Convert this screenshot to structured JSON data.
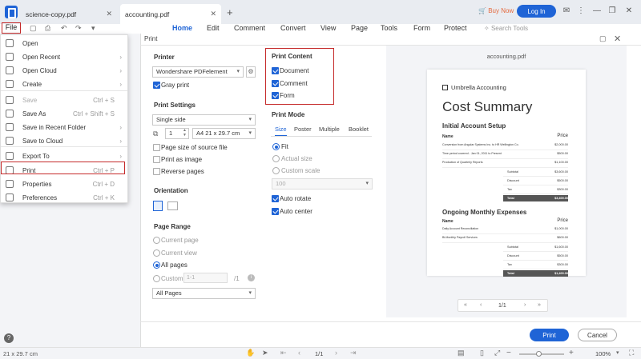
{
  "tabs": [
    {
      "label": "science-copy.pdf"
    },
    {
      "label": "accounting.pdf"
    }
  ],
  "header": {
    "buy_now": "Buy Now",
    "login": "Log In"
  },
  "toolbar": {
    "file": "File",
    "menus": [
      "Home",
      "Edit",
      "Comment",
      "Convert",
      "View",
      "Page",
      "Tools",
      "Form",
      "Protect"
    ],
    "search": "Search Tools"
  },
  "file_menu": [
    {
      "label": "Open",
      "shortcut": "",
      "arrow": false,
      "disabled": false
    },
    {
      "label": "Open Recent",
      "shortcut": "",
      "arrow": true,
      "disabled": false
    },
    {
      "label": "Open Cloud",
      "shortcut": "",
      "arrow": true,
      "disabled": false
    },
    {
      "label": "Create",
      "shortcut": "",
      "arrow": true,
      "disabled": false
    },
    {
      "label": "Save",
      "shortcut": "Ctrl + S",
      "arrow": false,
      "disabled": true
    },
    {
      "label": "Save As",
      "shortcut": "Ctrl + Shift + S",
      "arrow": false,
      "disabled": false
    },
    {
      "label": "Save in Recent Folder",
      "shortcut": "",
      "arrow": true,
      "disabled": false
    },
    {
      "label": "Save to Cloud",
      "shortcut": "",
      "arrow": true,
      "disabled": false
    },
    {
      "label": "Export To",
      "shortcut": "",
      "arrow": true,
      "disabled": false
    },
    {
      "label": "Print",
      "shortcut": "Ctrl + P",
      "arrow": false,
      "disabled": false
    },
    {
      "label": "Properties",
      "shortcut": "Ctrl + D",
      "arrow": false,
      "disabled": false
    },
    {
      "label": "Preferences",
      "shortcut": "Ctrl + K",
      "arrow": false,
      "disabled": false
    }
  ],
  "dialog": {
    "title": "Print",
    "printer": {
      "heading": "Printer",
      "selected": "Wondershare PDFelement",
      "gray_print": "Gray print",
      "gray_checked": true
    },
    "settings": {
      "heading": "Print Settings",
      "sides": "Single side",
      "copies": "1",
      "paper": "A4 21 x 29.7 cm",
      "options": [
        {
          "label": "Page size of source file",
          "checked": false
        },
        {
          "label": "Print as image",
          "checked": false
        },
        {
          "label": "Reverse pages",
          "checked": false
        }
      ]
    },
    "orientation": {
      "heading": "Orientation"
    },
    "page_range": {
      "heading": "Page Range",
      "options": [
        {
          "label": "Current page",
          "selected": false
        },
        {
          "label": "Current view",
          "selected": false
        },
        {
          "label": "All pages",
          "selected": true
        },
        {
          "label": "Custom",
          "selected": false
        }
      ],
      "custom_value": "1-1",
      "custom_total": "/1",
      "subset": "All Pages"
    },
    "print_content": {
      "heading": "Print Content",
      "items": [
        {
          "label": "Document",
          "checked": true
        },
        {
          "label": "Comment",
          "checked": true
        },
        {
          "label": "Form",
          "checked": true
        }
      ]
    },
    "print_mode": {
      "heading": "Print Mode",
      "tabs": [
        "Size",
        "Poster",
        "Multiple",
        "Booklet"
      ],
      "size_options": [
        {
          "label": "Fit",
          "selected": true
        },
        {
          "label": "Actual size",
          "selected": false
        },
        {
          "label": "Custom scale",
          "selected": false
        }
      ],
      "scale_value": "100",
      "auto_rotate": "Auto rotate",
      "auto_center": "Auto center"
    },
    "preview": {
      "filename": "accounting.pdf",
      "page_indicator": "1/1",
      "doc": {
        "brand": "Umbrella Accounting",
        "title": "Cost Summary",
        "section1": "Initial Account Setup",
        "col_name": "Name",
        "col_price": "Price",
        "rows1": [
          {
            "name": "Conversion from Angular Systems Inc. to HR Wellington Co.",
            "price": "$2,000.00"
          },
          {
            "name": "Time period covered - Jan 01, 2011 to Present",
            "price": "$500.00"
          },
          {
            "name": "Production of Quarterly Reports",
            "price": "$1,100.00"
          }
        ],
        "totals1": [
          {
            "label": "Subtotal",
            "value": "$3,600.00"
          },
          {
            "label": "Discount",
            "value": "$500.00"
          },
          {
            "label": "Tax",
            "value": "$300.00"
          },
          {
            "label": "Total",
            "value": "$3,400.00"
          }
        ],
        "section2": "Ongoing Monthly Expenses",
        "rows2": [
          {
            "name": "Daily Account Reconciliation",
            "price": "$1,000.00"
          },
          {
            "name": "Bi-Monthly Payroll Services",
            "price": "$600.00"
          }
        ],
        "totals2": [
          {
            "label": "Subtotal",
            "value": "$1,600.00"
          },
          {
            "label": "Discount",
            "value": "$500.00"
          },
          {
            "label": "Tax",
            "value": "$300.00"
          },
          {
            "label": "Total",
            "value": "$1,400.00"
          }
        ]
      }
    },
    "buttons": {
      "print": "Print",
      "cancel": "Cancel"
    }
  },
  "status": {
    "page_size": "21 x 29.7 cm",
    "page_nav": "1/1",
    "zoom": "100%"
  }
}
